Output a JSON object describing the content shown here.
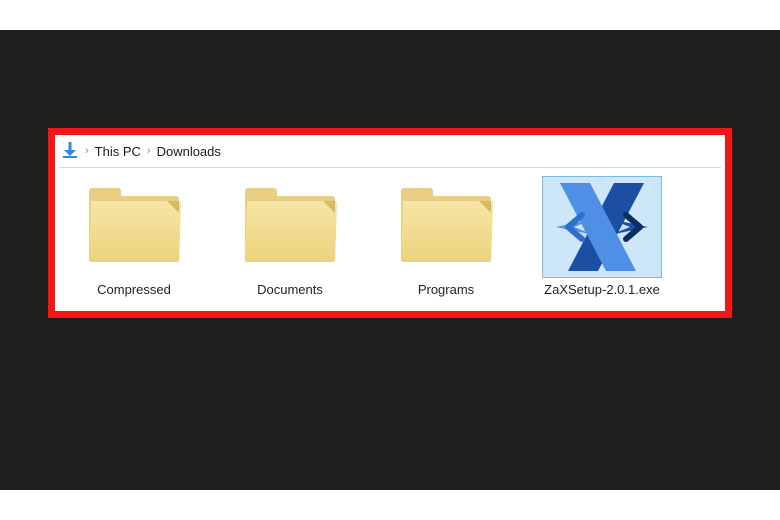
{
  "breadcrumb": {
    "icon": "download-arrow-icon",
    "parts": [
      "This PC",
      "Downloads"
    ]
  },
  "items": [
    {
      "name": "Compressed",
      "type": "folder",
      "selected": false
    },
    {
      "name": "Documents",
      "type": "folder",
      "selected": false
    },
    {
      "name": "Programs",
      "type": "folder",
      "selected": false
    },
    {
      "name": "ZaXSetup-2.0.1.exe",
      "type": "zax",
      "selected": true
    }
  ],
  "colors": {
    "highlight_border": "#f31616",
    "selection_bg": "#cde6f8",
    "selection_border": "#7fb8e0",
    "accent1": "#1a62c8",
    "accent2": "#4f8fe6"
  }
}
